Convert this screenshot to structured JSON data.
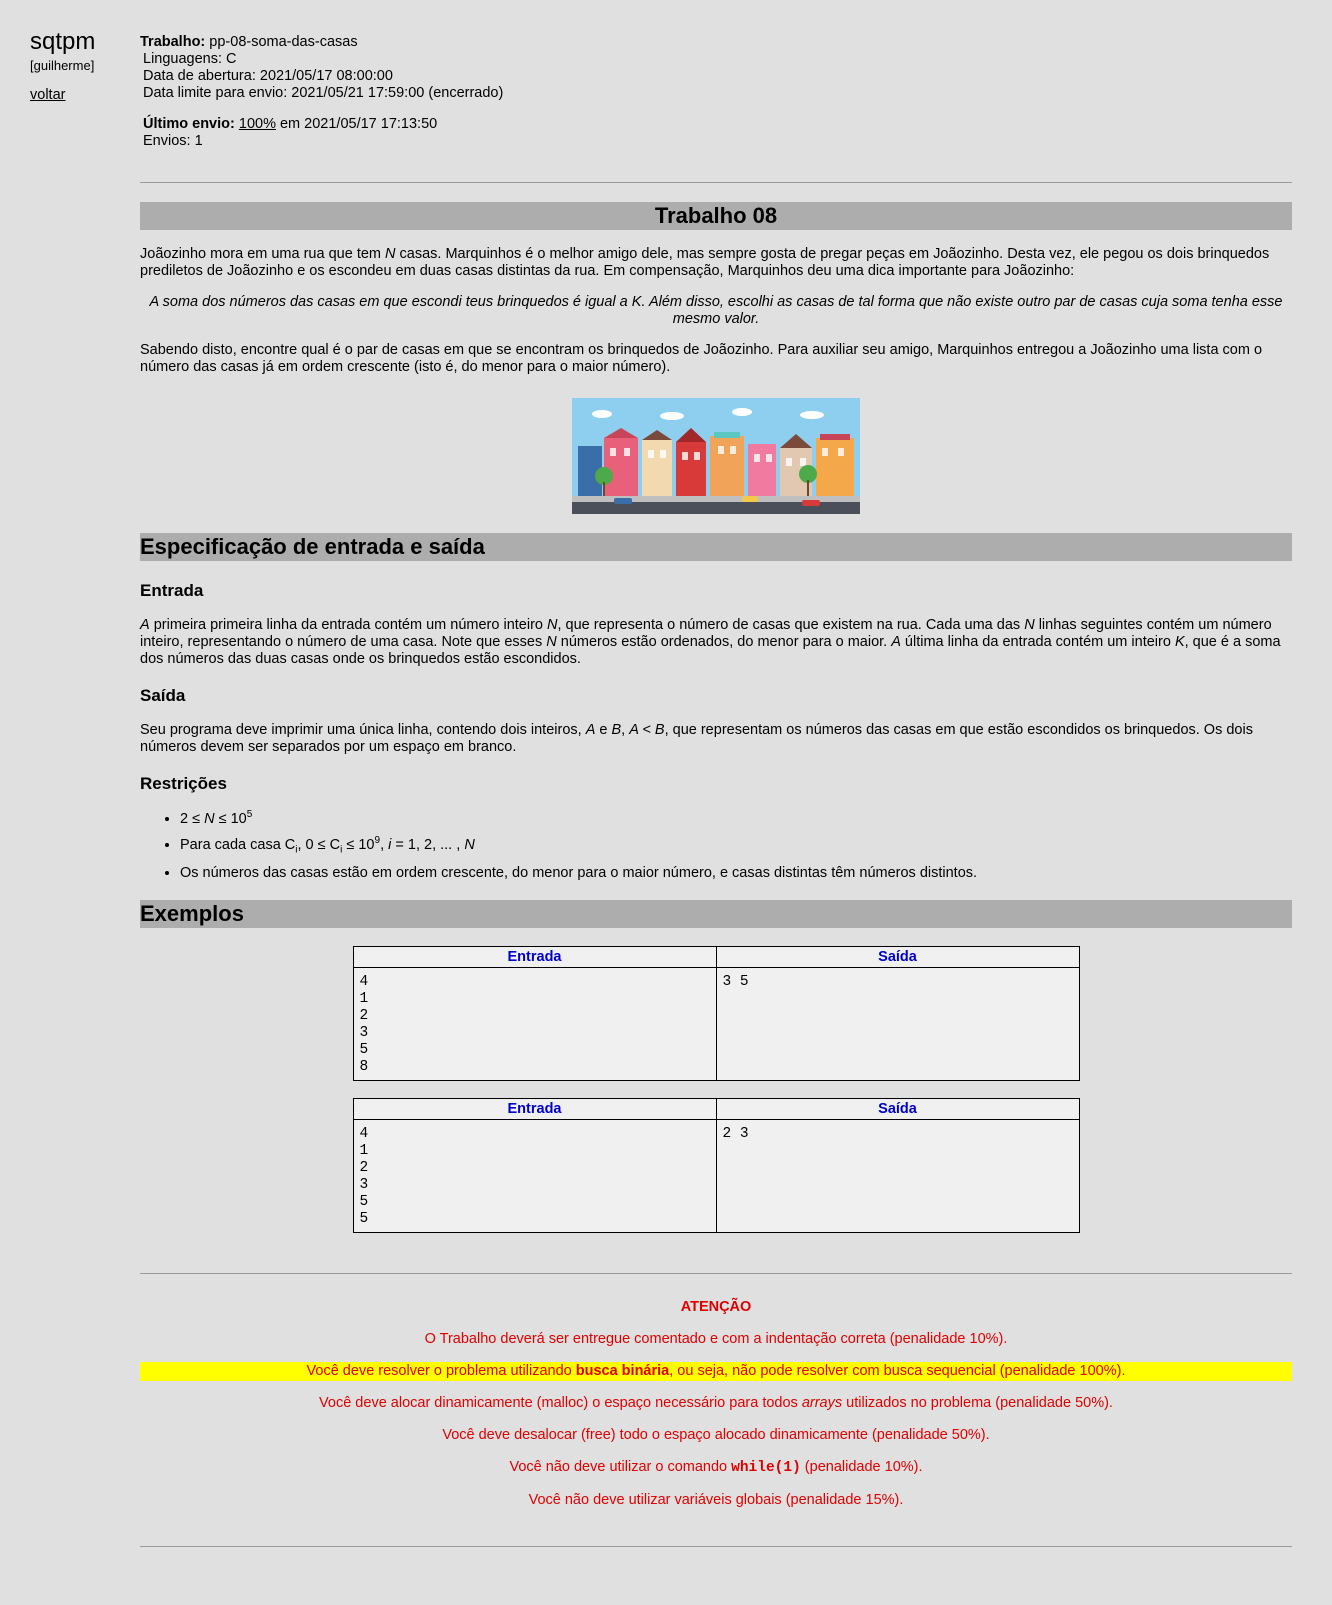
{
  "sidebar": {
    "brand": "sqtpm",
    "user": "[guilherme]",
    "back_link": "voltar"
  },
  "header": {
    "trabalho_label": "Trabalho:",
    "trabalho_value": "pp-08-soma-das-casas",
    "linguagens": "Linguagens: C",
    "abertura": "Data de abertura: 2021/05/17 08:00:00",
    "limite": "Data limite para envio: 2021/05/21 17:59:00 (encerrado)",
    "ultimo_label": "Último envio:",
    "ultimo_pct": "100%",
    "ultimo_date": " em 2021/05/17 17:13:50",
    "envios": "Envios: 1"
  },
  "problem": {
    "title": "Trabalho 08",
    "intro_a": "Joãozinho mora em uma rua que tem ",
    "intro_N": "N",
    "intro_b": " casas. Marquinhos é o melhor amigo dele, mas sempre gosta de pregar peças em Joãozinho. Desta vez, ele pegou os dois brinquedos prediletos de Joãozinho e os escondeu em duas casas distintas da rua. Em compensação, Marquinhos deu uma dica importante para Joãozinho:",
    "hint": "A soma dos números das casas em que escondi teus brinquedos é igual a K. Além disso, escolhi as casas de tal forma que não existe outro par de casas cuja soma tenha esse mesmo valor.",
    "knowing": "Sabendo disto, encontre qual é o par de casas em que se encontram os brinquedos de Joãozinho. Para auxiliar seu amigo, Marquinhos entregou a Joãozinho uma lista com o número das casas já em ordem crescente (isto é, do menor para o maior número)."
  },
  "spec": {
    "title": "Especificação de entrada e saída",
    "entrada_title": "Entrada",
    "entrada": {
      "A1": "A",
      "t1": " primeira primeira linha da entrada contém um número inteiro ",
      "N1": "N",
      "t2": ", que representa o número de casas que existem na rua. Cada uma das ",
      "N2": "N",
      "t3": " linhas seguintes contém um número inteiro, representando o número de uma casa. Note que esses ",
      "N3": "N",
      "t4": " números estão ordenados, do menor para o maior. ",
      "A2": "A",
      "t5": " última linha da entrada contém um inteiro ",
      "K": "K",
      "t6": ", que é a soma dos números das duas casas onde os brinquedos estão escondidos."
    },
    "saida_title": "Saída",
    "saida": {
      "t1": "Seu programa deve imprimir uma única linha, contendo dois inteiros, ",
      "A": "A",
      "e": " e ",
      "B": "B",
      "c": ", ",
      "AltB": "A < B",
      "t2": ", que representam os números das casas em que estão escondidos os brinquedos. Os dois números devem ser separados por um espaço em branco."
    },
    "restr_title": "Restrições",
    "restr1": {
      "a": "2 ≤ ",
      "N": "N",
      "b": " ≤ 10",
      "exp": "5"
    },
    "restr2": {
      "a": "Para cada casa C",
      "sub1": "i",
      "b": ", 0 ≤ C",
      "sub2": "i",
      "c": " ≤ 10",
      "exp": "9",
      "d": ", ",
      "i": "i",
      "e": " = 1, 2, ... , ",
      "N": "N"
    },
    "restr3": "Os números das casas estão em ordem crescente, do menor para o maior número, e casas distintas têm números distintos."
  },
  "examples": {
    "title": "Exemplos",
    "col_in": "Entrada",
    "col_out": "Saída",
    "ex1_in": "4\n1\n2\n3\n5\n8",
    "ex1_out": "3 5",
    "ex2_in": "4\n1\n2\n3\n5\n5",
    "ex2_out": "2 3"
  },
  "attention": {
    "title": "ATENÇÃO",
    "l1": "O Trabalho deverá ser entregue comentado e com a indentação correta (penalidade 10%).",
    "l2a": "Você deve resolver o problema utilizando ",
    "l2b": "busca binária",
    "l2c": ", ou seja, não pode resolver com busca sequencial (penalidade 100%).",
    "l3a": "Você deve alocar dinamicamente (malloc) o espaço necessário para todos ",
    "l3b": "arrays",
    "l3c": " utilizados no problema (penalidade 50%).",
    "l4": "Você deve desalocar (free) todo o espaço alocado dinamicamente (penalidade 50%).",
    "l5a": "Você não deve utilizar o comando ",
    "l5b": "while(1)",
    "l5c": " (penalidade 10%).",
    "l6": "Você não deve utilizar variáveis globais (penalidade 15%)."
  },
  "colors": {
    "accent_blue": "#0000cc",
    "warning_red": "#e00000",
    "highlight": "#ffff00",
    "bar_gray": "#adadad"
  }
}
